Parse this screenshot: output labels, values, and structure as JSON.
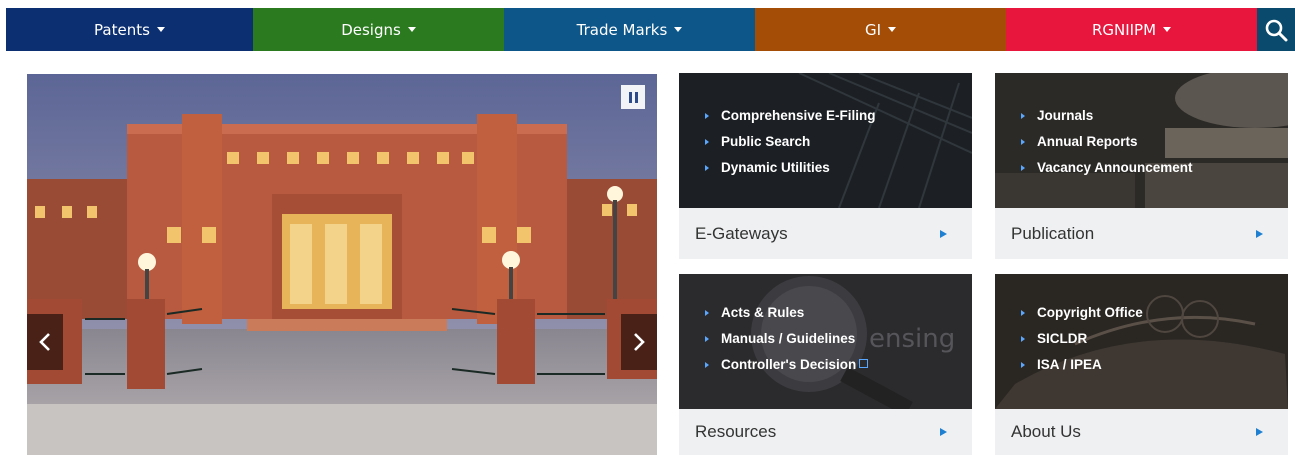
{
  "nav": {
    "items": [
      {
        "label": "Patents",
        "color": "#0c2f72"
      },
      {
        "label": "Designs",
        "color": "#2b7a1f"
      },
      {
        "label": "Trade Marks",
        "color": "#0d568a"
      },
      {
        "label": "GI",
        "color": "#a34d07"
      },
      {
        "label": "RGNIIPM",
        "color": "#e8153c"
      }
    ],
    "search_icon": "search-icon",
    "search_color": "#0a4a6c"
  },
  "slider": {
    "pause_icon": "pause-icon",
    "prev_icon": "chevron-left-icon",
    "next_icon": "chevron-right-icon"
  },
  "tiles": [
    {
      "title": "E-Gateways",
      "links": [
        "Comprehensive E-Filing",
        "Public Search",
        "Dynamic Utilities"
      ]
    },
    {
      "title": "Publication",
      "links": [
        "Journals",
        "Annual Reports",
        "Vacancy Announcement"
      ]
    },
    {
      "title": "Resources",
      "links": [
        "Acts & Rules",
        "Manuals / Guidelines",
        "Controller's Decision"
      ],
      "background_text": "ensing"
    },
    {
      "title": "About Us",
      "links": [
        "Copyright Office",
        "SICLDR",
        "ISA / IPEA"
      ]
    }
  ],
  "colors": {
    "bullet": "#5aa7ff",
    "footer_arrow": "#1f7fd1",
    "footer_bg": "#eef0f2"
  }
}
